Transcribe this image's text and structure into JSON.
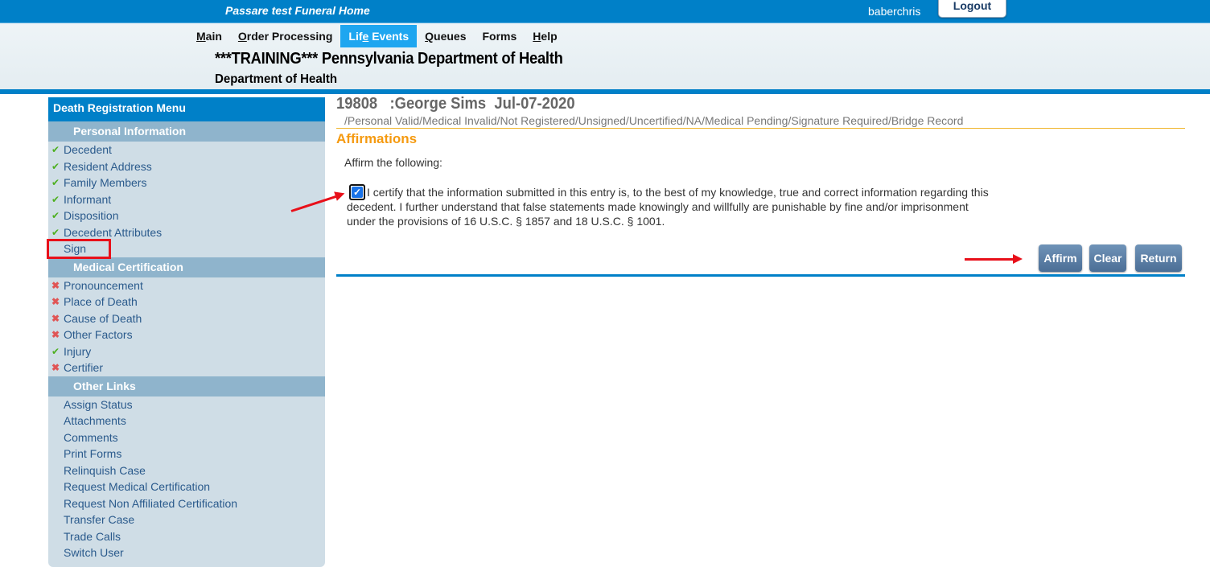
{
  "topbar": {
    "brand": "Passare test Funeral Home",
    "username": "baberchris",
    "logout_label": "Logout"
  },
  "nav": {
    "items": [
      {
        "pre": "",
        "key": "M",
        "post": "ain"
      },
      {
        "pre": "",
        "key": "O",
        "post": "rder Processing"
      },
      {
        "pre": "Lif",
        "key": "e",
        "post": " Events",
        "active": true
      },
      {
        "pre": "",
        "key": "Q",
        "post": "ueues"
      },
      {
        "pre": "Forms",
        "key": "",
        "post": ""
      },
      {
        "pre": "",
        "key": "H",
        "post": "elp"
      }
    ]
  },
  "header": {
    "title": "***TRAINING*** Pennsylvania Department of Health",
    "subtitle": "Department of Health"
  },
  "sidebar": {
    "title": "Death Registration Menu",
    "sections": [
      {
        "label": "Personal Information",
        "items": [
          {
            "label": "Decedent",
            "status": "ok"
          },
          {
            "label": "Resident Address",
            "status": "ok"
          },
          {
            "label": "Family Members",
            "status": "ok"
          },
          {
            "label": "Informant",
            "status": "ok"
          },
          {
            "label": "Disposition",
            "status": "ok"
          },
          {
            "label": "Decedent Attributes",
            "status": "ok"
          },
          {
            "label": "Sign",
            "status": "none"
          }
        ]
      },
      {
        "label": "Medical Certification",
        "items": [
          {
            "label": "Pronouncement",
            "status": "bad"
          },
          {
            "label": "Place of Death",
            "status": "bad"
          },
          {
            "label": "Cause of Death",
            "status": "bad"
          },
          {
            "label": "Other Factors",
            "status": "bad"
          },
          {
            "label": "Injury",
            "status": "ok"
          },
          {
            "label": "Certifier",
            "status": "bad"
          }
        ]
      },
      {
        "label": "Other Links",
        "items": [
          {
            "label": "Assign Status",
            "status": "none"
          },
          {
            "label": "Attachments",
            "status": "none"
          },
          {
            "label": "Comments",
            "status": "none"
          },
          {
            "label": "Print Forms",
            "status": "none"
          },
          {
            "label": "Relinquish Case",
            "status": "none"
          },
          {
            "label": "Request Medical Certification",
            "status": "none"
          },
          {
            "label": "Request Non Affiliated Certification",
            "status": "none"
          },
          {
            "label": "Transfer Case",
            "status": "none"
          },
          {
            "label": "Trade Calls",
            "status": "none"
          },
          {
            "label": "Switch User",
            "status": "none"
          }
        ]
      }
    ]
  },
  "main": {
    "case_title": "19808   :George Sims  Jul-07-2020",
    "status_line": "/Personal Valid/Medical Invalid/Not Registered/Unsigned/Uncertified/NA/Medical Pending/Signature Required/Bridge Record",
    "section_title": "Affirmations",
    "affirm_label": "Affirm the following:",
    "certification_checked": true,
    "certification_text": "I certify that the information submitted in this entry is, to the best of my knowledge, true and correct information regarding this decedent. I further understand that false statements made knowingly and willfully are punishable by fine and/or imprisonment under the provisions of 16 U.S.C. § 1857 and 18 U.S.C. § 1001.",
    "buttons": {
      "affirm": "Affirm",
      "clear": "Clear",
      "return": "Return"
    }
  },
  "icons": {
    "ok": "✔",
    "bad": "✖",
    "check": "✓"
  },
  "colors": {
    "brand_blue": "#0080c8",
    "active_tab": "#1ea6f0",
    "section_orange": "#f59a10",
    "annotation_red": "#e8101a"
  }
}
